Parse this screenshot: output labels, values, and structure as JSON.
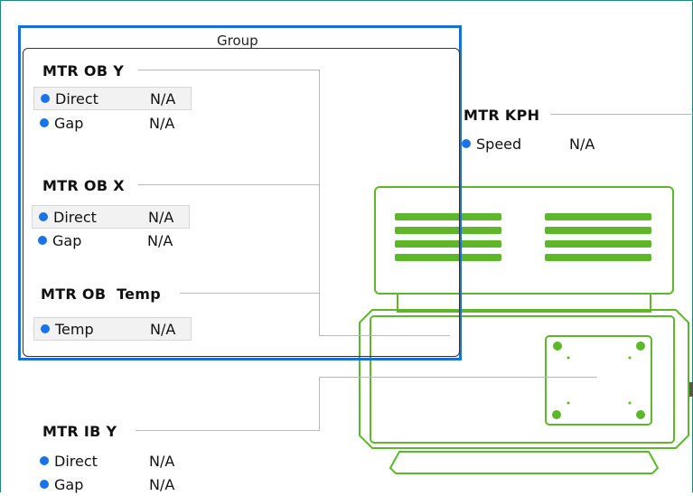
{
  "group": {
    "title": "Group"
  },
  "sections": {
    "mtr_ob_y": {
      "title": "MTR OB Y",
      "rows": [
        {
          "label": "Direct",
          "value": "N/A"
        },
        {
          "label": "Gap",
          "value": "N/A"
        }
      ]
    },
    "mtr_ob_x": {
      "title": "MTR OB X",
      "rows": [
        {
          "label": "Direct",
          "value": "N/A"
        },
        {
          "label": "Gap",
          "value": "N/A"
        }
      ]
    },
    "mtr_ob_temp": {
      "title": "MTR OB  Temp",
      "rows": [
        {
          "label": "Temp",
          "value": "N/A"
        }
      ]
    },
    "mtr_kph": {
      "title": "MTR KPH",
      "rows": [
        {
          "label": "Speed",
          "value": "N/A"
        }
      ]
    },
    "mtr_ib_y": {
      "title": "MTR IB Y",
      "rows": [
        {
          "label": "Direct",
          "value": "N/A"
        },
        {
          "label": "Gap",
          "value": "N/A"
        }
      ]
    }
  },
  "colors": {
    "selection": "#1670d8",
    "motor": "#5cb82a",
    "status_dot": "#1a73e8"
  }
}
